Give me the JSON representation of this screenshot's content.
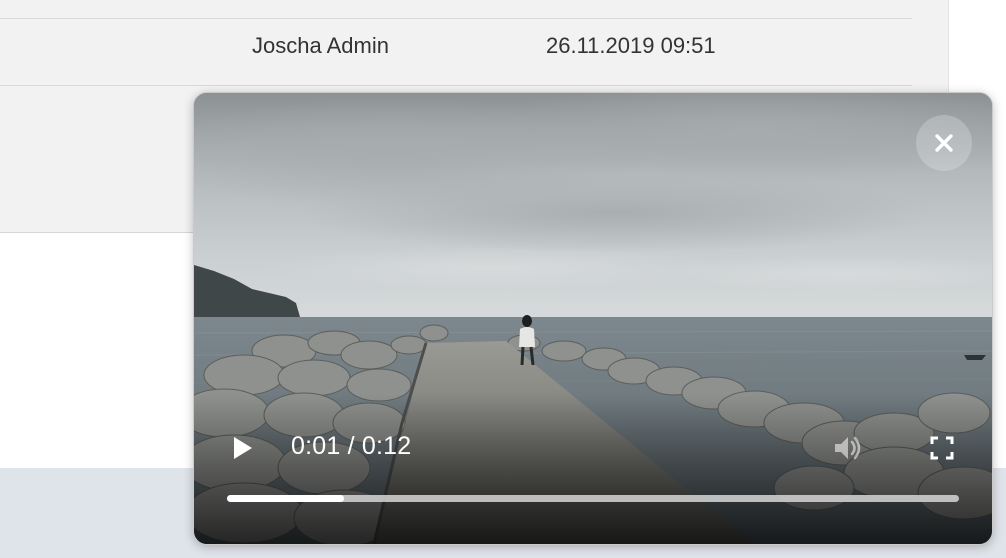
{
  "list": {
    "row": {
      "author": "Joscha Admin",
      "date": "26.11.2019 09:51"
    }
  },
  "video": {
    "current_time": "0:01",
    "separator": " / ",
    "duration": "0:12",
    "progress_fraction": 0.16,
    "icons": {
      "close": "close-icon",
      "play": "play-icon",
      "volume": "volume-icon",
      "fullscreen": "fullscreen-icon"
    }
  }
}
